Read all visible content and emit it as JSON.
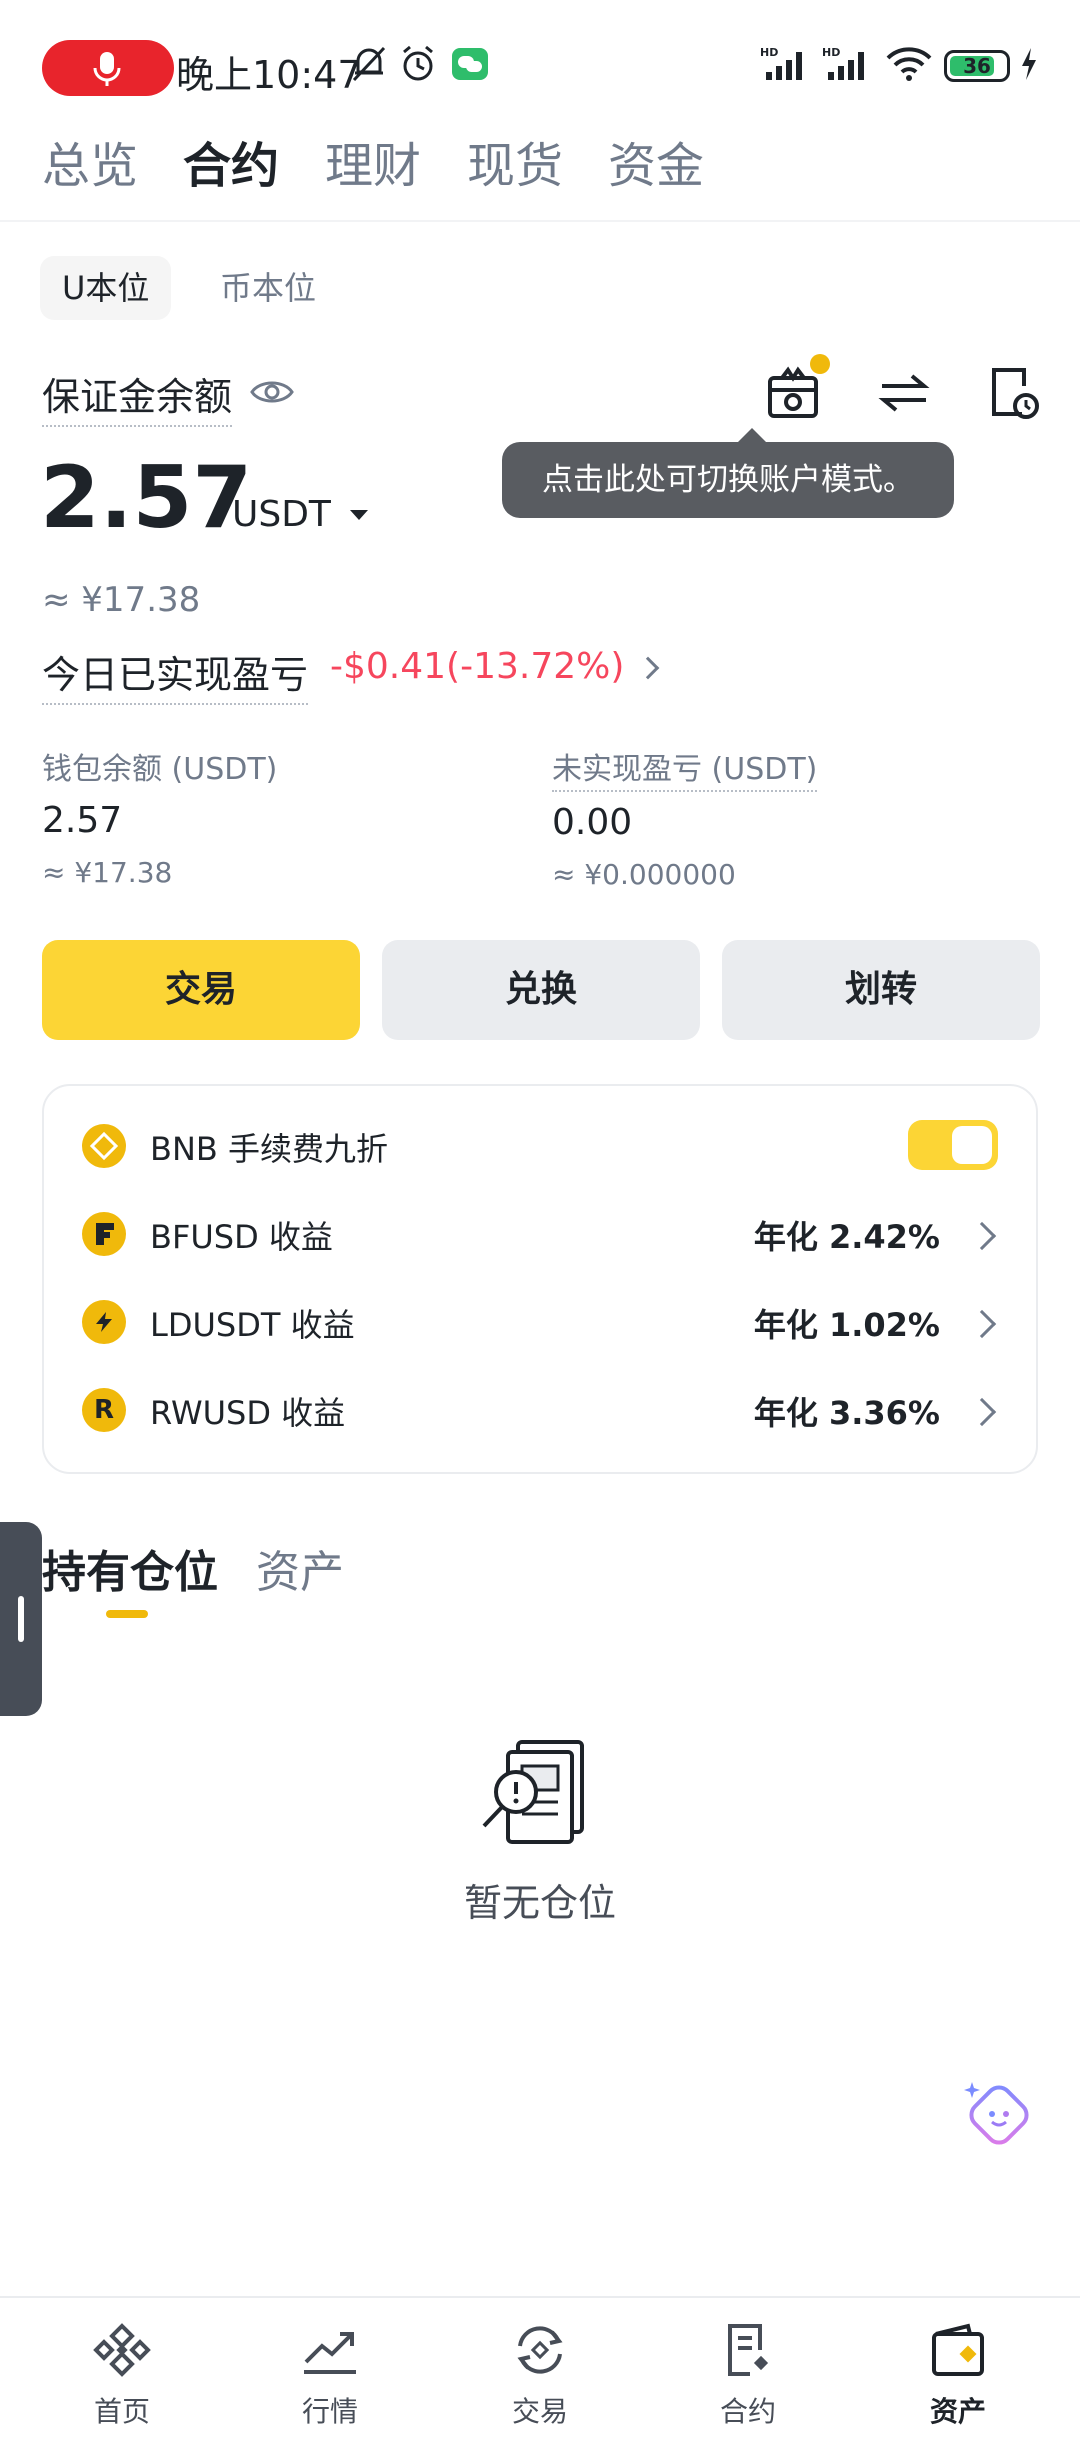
{
  "status_bar": {
    "time": "晚上10:47",
    "battery": "36",
    "icons": [
      "mic-icon",
      "dnd-icon",
      "alarm-icon",
      "wechat-icon",
      "signal-hd-icon",
      "signal-hd-icon",
      "wifi-icon",
      "battery-icon",
      "charging-icon"
    ]
  },
  "top_tabs": [
    {
      "label": "总览",
      "active": false
    },
    {
      "label": "合约",
      "active": true
    },
    {
      "label": "理财",
      "active": false
    },
    {
      "label": "现货",
      "active": false
    },
    {
      "label": "资金",
      "active": false
    }
  ],
  "segments": [
    {
      "label": "U本位",
      "active": true
    },
    {
      "label": "币本位",
      "active": false
    }
  ],
  "margin": {
    "label": "保证金余额",
    "balance": "2.57",
    "currency": "USDT",
    "cny": "≈ ¥17.38",
    "pnl_label": "今日已实现盈亏",
    "pnl_value": "-$0.41(-13.72%)"
  },
  "tooltip": "点击此处可切换账户模式。",
  "wallet": {
    "label": "钱包余额 (USDT)",
    "value": "2.57",
    "cny": "≈ ¥17.38"
  },
  "unrealized": {
    "label": "未实现盈亏 (USDT)",
    "value": "0.00",
    "cny": "≈ ¥0.000000"
  },
  "actions": {
    "trade": "交易",
    "convert": "兑换",
    "transfer": "划转"
  },
  "card": {
    "bnb_label": "BNB 手续费九折",
    "bnb_toggle": true,
    "yields": [
      {
        "label": "BFUSD 收益",
        "rate": "年化 2.42%"
      },
      {
        "label": "LDUSDT 收益",
        "rate": "年化 1.02%"
      },
      {
        "label": "RWUSD 收益",
        "rate": "年化 3.36%"
      }
    ]
  },
  "positions_tabs": [
    {
      "label": "持有仓位",
      "active": true
    },
    {
      "label": "资产",
      "active": false
    }
  ],
  "empty_text": "暂无仓位",
  "bottom_nav": [
    {
      "label": "首页",
      "active": false
    },
    {
      "label": "行情",
      "active": false
    },
    {
      "label": "交易",
      "active": false
    },
    {
      "label": "合约",
      "active": false
    },
    {
      "label": "资产",
      "active": true
    }
  ],
  "colors": {
    "accent": "#fcd535",
    "loss": "#f6465d",
    "text_primary": "#1e2329",
    "text_secondary": "#707a8a"
  }
}
